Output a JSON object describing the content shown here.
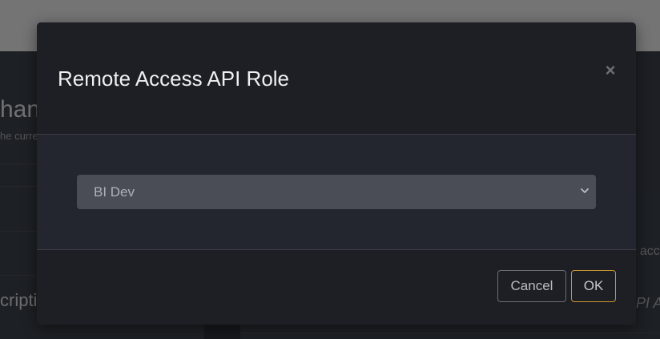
{
  "background": {
    "heading_fragment": "hant",
    "subtext_fragment": "he curre",
    "left_label_fragment": "cripti",
    "right_text_fragment": "t acc",
    "right_italic_fragment": "PI A"
  },
  "modal": {
    "title": "Remote Access API Role",
    "close_symbol": "×",
    "select": {
      "selected_value": "BI Dev"
    },
    "footer": {
      "cancel_label": "Cancel",
      "ok_label": "OK"
    }
  },
  "colors": {
    "accent_ok_border": "#c9952f",
    "modal_bg": "#1f2025",
    "select_bg": "#4a4d55"
  }
}
